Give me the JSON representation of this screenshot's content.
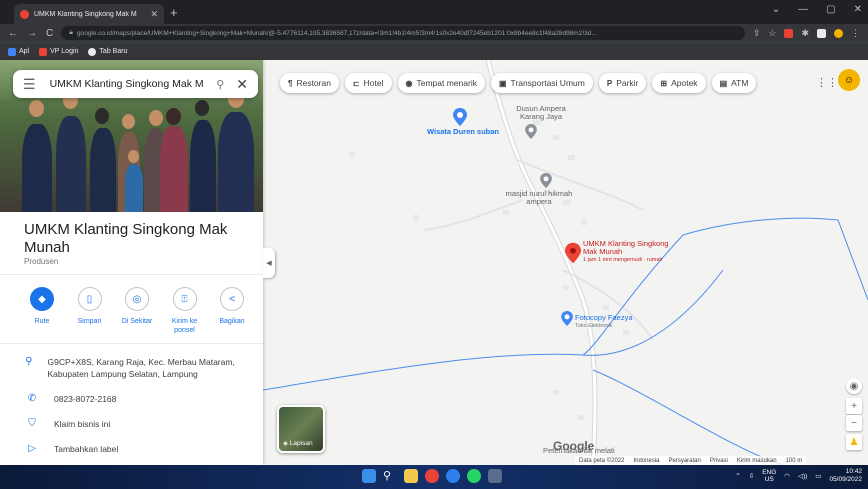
{
  "browser": {
    "tab_title": "UMKM Klanting Singkong Mak M",
    "url": "google.co.id/maps/place/UMKM+Klanting+Singkong+Mak+Munah/@-5.4776114,105.3836587,17z/data=!3m1!4b1!4m5!3m4!1s0x2e40df7245eb1201:0x8b4ee8c1f48a28d98m2!3d...",
    "bookmarks": [
      "Apl",
      "VP Login",
      "Tab Baru"
    ]
  },
  "search": {
    "query": "UMKM Klanting Singkong Mak M"
  },
  "place": {
    "title": "UMKM Klanting Singkong Mak Munah",
    "category": "Produsen",
    "actions": [
      {
        "icon": "directions-icon",
        "label": "Rute"
      },
      {
        "icon": "bookmark-icon",
        "label": "Simpan"
      },
      {
        "icon": "nearby-icon",
        "label": "Di Sekitar"
      },
      {
        "icon": "send-to-phone-icon",
        "label": "Kirim ke ponsel"
      },
      {
        "icon": "share-icon",
        "label": "Bagikan"
      }
    ],
    "address": "G9CP+X8S, Karang Raja, Kec. Merbau Mataram, Kabupaten Lampung Selatan, Lampung",
    "phone": "0823-8072-2168",
    "claim": "Klaim bisnis ini",
    "add_label": "Tambahkan label"
  },
  "chips": [
    {
      "icon": "restaurant-icon",
      "glyph": "¶",
      "label": "Restoran"
    },
    {
      "icon": "hotel-icon",
      "glyph": "⊏",
      "label": "Hotel"
    },
    {
      "icon": "attraction-icon",
      "glyph": "◉",
      "label": "Tempat menarik"
    },
    {
      "icon": "transit-icon",
      "glyph": "▣",
      "label": "Transportasi Umum"
    },
    {
      "icon": "parking-icon",
      "glyph": "P",
      "label": "Parkir"
    },
    {
      "icon": "pharmacy-icon",
      "glyph": "⊞",
      "label": "Apotek"
    },
    {
      "icon": "atm-icon",
      "glyph": "▤",
      "label": "ATM"
    }
  ],
  "map": {
    "labels": {
      "dusun": "Dusun Ampera Karang Jaya",
      "wisata": "Wisata Duren suban",
      "masjid": "masjid nurul hikmah ampera",
      "pin_name": "UMKM Klanting Singkong Mak Munah",
      "pin_sub": "1 jam 1 mnt mengemudi · rumah",
      "fotocopy": "Fotocopy Faezya",
      "fotocopy_sub": "Toko Elektronik",
      "bottom": "Peternakan itik melati"
    },
    "layers_label": "Lapisan",
    "attribution": [
      "Data peta ©2022",
      "Indonesia",
      "Persyaratan",
      "Privasi",
      "Kirim masukan",
      "100 m"
    ]
  },
  "taskbar": {
    "lang1": "ENG",
    "lang2": "US",
    "time": "10:42",
    "date": "05/09/2022"
  },
  "colors": {
    "accent": "#1a73e8",
    "pin": "#ea4335",
    "boundary": "#4a8cf0"
  }
}
